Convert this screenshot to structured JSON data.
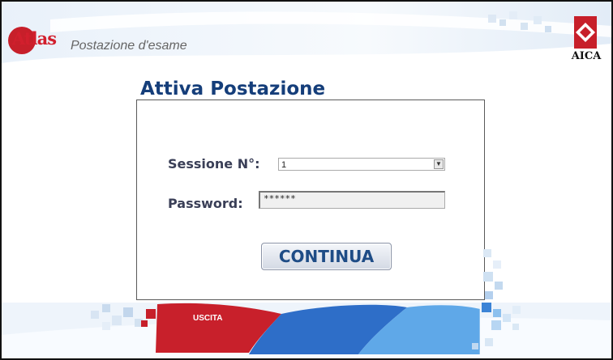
{
  "header": {
    "logo_text": "Atlas",
    "subtitle": "Postazione d'esame",
    "brand": "AICA"
  },
  "main": {
    "title": "Attiva Postazione",
    "session_label": "Sessione N°:",
    "session_value": "1",
    "password_label": "Password:",
    "password_value": "******",
    "continue_label": "CONTINUA"
  },
  "footer": {
    "exit_label": "USCITA"
  },
  "colors": {
    "title": "#153e7a",
    "brand_red": "#c71f2a",
    "band_blue": "#2e6ec8"
  }
}
